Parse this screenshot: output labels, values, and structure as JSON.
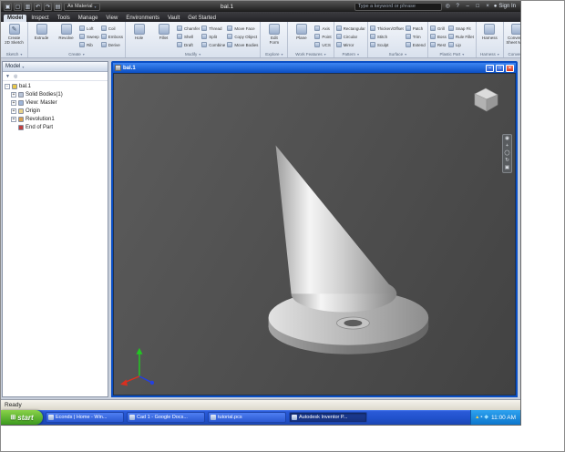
{
  "titlebar": {
    "document_title": "bal.1",
    "material_label": "As Material",
    "search_placeholder": "Type a keyword or phrase",
    "sign_in_label": "Sign In",
    "quick_access_icons": [
      {
        "name": "app-menu-icon",
        "glyph": "▣"
      },
      {
        "name": "new-file-icon",
        "glyph": "▢"
      },
      {
        "name": "save-icon",
        "glyph": "▥"
      },
      {
        "name": "undo-icon",
        "glyph": "↶"
      },
      {
        "name": "redo-icon",
        "glyph": "↷"
      },
      {
        "name": "print-icon",
        "glyph": "▤"
      }
    ],
    "right_icons": [
      {
        "name": "search-go-icon",
        "glyph": "◎"
      },
      {
        "name": "help-icon",
        "glyph": "?"
      },
      {
        "name": "minimize-icon",
        "glyph": "–"
      },
      {
        "name": "maximize-icon",
        "glyph": "□"
      },
      {
        "name": "close-icon",
        "glyph": "×"
      }
    ]
  },
  "tabs": {
    "items": [
      {
        "label": "Model",
        "active": true
      },
      {
        "label": "Inspect"
      },
      {
        "label": "Tools"
      },
      {
        "label": "Manage"
      },
      {
        "label": "View"
      },
      {
        "label": "Environments"
      },
      {
        "label": "Vault"
      },
      {
        "label": "Get Started"
      }
    ]
  },
  "ribbon": {
    "groups": [
      {
        "label": "Sketch",
        "columns": [
          {
            "type": "big",
            "label": "Create\n2D Sketch",
            "icon": "create-2d-sketch-icon",
            "glyph": "✎"
          }
        ]
      },
      {
        "label": "Create",
        "columns": [
          {
            "type": "big",
            "label": "Extrude",
            "icon": "extrude-icon"
          },
          {
            "type": "big",
            "label": "Revolve",
            "icon": "revolve-icon"
          },
          {
            "type": "small",
            "items": [
              {
                "label": "Loft",
                "icon": "loft-icon"
              },
              {
                "label": "Sweep",
                "icon": "sweep-icon"
              },
              {
                "label": "Rib",
                "icon": "rib-icon"
              }
            ]
          },
          {
            "type": "small",
            "items": [
              {
                "label": "Coil",
                "icon": "coil-icon"
              },
              {
                "label": "Emboss",
                "icon": "emboss-icon"
              },
              {
                "label": "Derive",
                "icon": "derive-icon"
              }
            ]
          }
        ]
      },
      {
        "label": "Modify",
        "columns": [
          {
            "type": "big",
            "label": "Hole",
            "icon": "hole-icon"
          },
          {
            "type": "big",
            "label": "Fillet",
            "icon": "fillet-icon"
          },
          {
            "type": "small",
            "items": [
              {
                "label": "Chamfer",
                "icon": "chamfer-icon"
              },
              {
                "label": "Shell",
                "icon": "shell-icon"
              },
              {
                "label": "Draft",
                "icon": "draft-icon"
              }
            ]
          },
          {
            "type": "small",
            "items": [
              {
                "label": "Thread",
                "icon": "thread-icon"
              },
              {
                "label": "Split",
                "icon": "split-icon"
              },
              {
                "label": "Combine",
                "icon": "combine-icon"
              }
            ]
          },
          {
            "type": "small",
            "items": [
              {
                "label": "Move Face",
                "icon": "move-face-icon"
              },
              {
                "label": "Copy Object",
                "icon": "copy-object-icon"
              },
              {
                "label": "Move Bodies",
                "icon": "move-bodies-icon"
              }
            ]
          }
        ]
      },
      {
        "label": "Explore",
        "columns": [
          {
            "type": "big",
            "label": "Edit\nForm",
            "icon": "edit-form-icon"
          }
        ]
      },
      {
        "label": "Work Features",
        "columns": [
          {
            "type": "big",
            "label": "Plane",
            "icon": "plane-icon"
          },
          {
            "type": "small",
            "items": [
              {
                "label": "Axis",
                "icon": "axis-icon"
              },
              {
                "label": "Point",
                "icon": "point-icon"
              },
              {
                "label": "UCS",
                "icon": "ucs-icon"
              }
            ]
          }
        ]
      },
      {
        "label": "Pattern",
        "columns": [
          {
            "type": "small",
            "items": [
              {
                "label": "Rectangular",
                "icon": "rectangular-pattern-icon"
              },
              {
                "label": "Circular",
                "icon": "circular-pattern-icon"
              },
              {
                "label": "Mirror",
                "icon": "mirror-icon"
              }
            ]
          }
        ]
      },
      {
        "label": "Surface",
        "columns": [
          {
            "type": "small",
            "items": [
              {
                "label": "Thicken/Offset",
                "icon": "thicken-offset-icon"
              },
              {
                "label": "Stitch",
                "icon": "stitch-icon"
              },
              {
                "label": "Sculpt",
                "icon": "sculpt-icon"
              }
            ]
          },
          {
            "type": "small",
            "items": [
              {
                "label": "Patch",
                "icon": "patch-icon"
              },
              {
                "label": "Trim",
                "icon": "trim-icon"
              },
              {
                "label": "Extend",
                "icon": "extend-icon"
              }
            ]
          }
        ]
      },
      {
        "label": "Plastic Part",
        "columns": [
          {
            "type": "small",
            "items": [
              {
                "label": "Grill",
                "icon": "grill-icon"
              },
              {
                "label": "Boss",
                "icon": "boss-icon"
              },
              {
                "label": "Rest",
                "icon": "rest-icon"
              }
            ]
          },
          {
            "type": "small",
            "items": [
              {
                "label": "Snap Fit",
                "icon": "snap-fit-icon"
              },
              {
                "label": "Rule Fillet",
                "icon": "rule-fillet-icon"
              },
              {
                "label": "Lip",
                "icon": "lip-icon"
              }
            ]
          }
        ]
      },
      {
        "label": "Harness",
        "columns": [
          {
            "type": "big",
            "label": "Harness",
            "icon": "harness-icon"
          }
        ]
      },
      {
        "label": "Convert",
        "columns": [
          {
            "type": "big",
            "label": "Convert to\nSheet Metal",
            "icon": "convert-to-sheet-metal-icon"
          }
        ]
      }
    ]
  },
  "browser": {
    "header": "Model",
    "header_arrow": "▾",
    "toolbar_icons": [
      {
        "name": "filter-icon",
        "glyph": "▼"
      },
      {
        "name": "search-tree-icon",
        "glyph": "◎"
      }
    ],
    "tree": [
      {
        "label": "bal.1",
        "icon": "part-document-icon",
        "color": "#e8c84a",
        "depth": 0,
        "expander": "-"
      },
      {
        "label": "Solid Bodies(1)",
        "icon": "solid-bodies-folder-icon",
        "color": "#b9c4d6",
        "depth": 1,
        "expander": "+"
      },
      {
        "label": "View: Master",
        "icon": "view-master-icon",
        "color": "#9fb6d8",
        "depth": 1,
        "expander": "+"
      },
      {
        "label": "Origin",
        "icon": "origin-folder-icon",
        "color": "#e8d28a",
        "depth": 1,
        "expander": "+"
      },
      {
        "label": "Revolution1",
        "icon": "revolution-feature-icon",
        "color": "#d8a050",
        "depth": 1,
        "expander": "+"
      },
      {
        "label": "End of Part",
        "icon": "end-of-part-icon",
        "color": "#c04040",
        "depth": 1,
        "expander": ""
      }
    ]
  },
  "document": {
    "title": "bal.1",
    "minimize_glyph": "–",
    "maximize_glyph": "□",
    "close_glyph": "×"
  },
  "viewport": {
    "nav_icons": [
      {
        "name": "navigation-wheel-icon",
        "glyph": "◉"
      },
      {
        "name": "pan-icon",
        "glyph": "+"
      },
      {
        "name": "zoom-icon",
        "glyph": "◯"
      },
      {
        "name": "orbit-icon",
        "glyph": "↻"
      },
      {
        "name": "viewcube-home-icon",
        "glyph": "▣"
      }
    ]
  },
  "statusbar": {
    "text": "Ready"
  },
  "taskbar": {
    "start_label": "start",
    "start_flag_glyph": "⊞",
    "buttons": [
      {
        "label": "Econds | Home - Win...",
        "icon": "internet-explorer-icon"
      },
      {
        "label": "Cad 1 - Google Docs...",
        "icon": "google-docs-icon"
      },
      {
        "label": "tutorial.pcs",
        "icon": "document-icon"
      },
      {
        "label": "Autodesk Inventor P...",
        "icon": "autodesk-inventor-icon",
        "active": true
      }
    ],
    "tray_icons": [
      {
        "name": "tray-icon-alert",
        "glyph": "▴",
        "color": "#ffd24a"
      },
      {
        "name": "tray-icon-volume",
        "glyph": "▪",
        "color": "#cfe6ff"
      },
      {
        "name": "tray-icon-network",
        "glyph": "◆",
        "color": "#9fe0ff"
      }
    ],
    "tray_time": "11:00 AM"
  }
}
